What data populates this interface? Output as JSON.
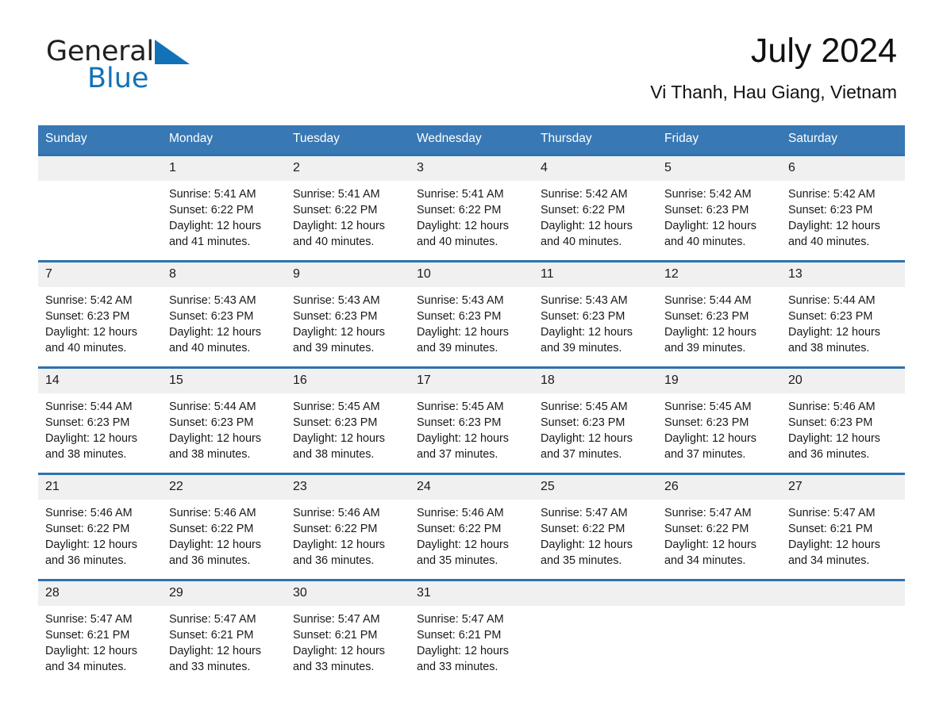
{
  "brand": {
    "name_part1": "General",
    "name_part2": "Blue",
    "triangle_color": "#1272b8"
  },
  "header": {
    "title": "July 2024",
    "subtitle": "Vi Thanh, Hau Giang, Vietnam"
  },
  "theme": {
    "header_blue": "#3878b4",
    "row_border_blue": "#2e72ae",
    "daynum_strip": "#f0f0f0",
    "text": "#1a1a1a"
  },
  "weekday_headers": [
    "Sunday",
    "Monday",
    "Tuesday",
    "Wednesday",
    "Thursday",
    "Friday",
    "Saturday"
  ],
  "weeks": [
    [
      {
        "day": "",
        "empty": true,
        "sunrise": "",
        "sunset": "",
        "daylight_line1": "",
        "daylight_line2": ""
      },
      {
        "day": "1",
        "empty": false,
        "sunrise": "Sunrise: 5:41 AM",
        "sunset": "Sunset: 6:22 PM",
        "daylight_line1": "Daylight: 12 hours",
        "daylight_line2": "and 41 minutes."
      },
      {
        "day": "2",
        "empty": false,
        "sunrise": "Sunrise: 5:41 AM",
        "sunset": "Sunset: 6:22 PM",
        "daylight_line1": "Daylight: 12 hours",
        "daylight_line2": "and 40 minutes."
      },
      {
        "day": "3",
        "empty": false,
        "sunrise": "Sunrise: 5:41 AM",
        "sunset": "Sunset: 6:22 PM",
        "daylight_line1": "Daylight: 12 hours",
        "daylight_line2": "and 40 minutes."
      },
      {
        "day": "4",
        "empty": false,
        "sunrise": "Sunrise: 5:42 AM",
        "sunset": "Sunset: 6:22 PM",
        "daylight_line1": "Daylight: 12 hours",
        "daylight_line2": "and 40 minutes."
      },
      {
        "day": "5",
        "empty": false,
        "sunrise": "Sunrise: 5:42 AM",
        "sunset": "Sunset: 6:23 PM",
        "daylight_line1": "Daylight: 12 hours",
        "daylight_line2": "and 40 minutes."
      },
      {
        "day": "6",
        "empty": false,
        "sunrise": "Sunrise: 5:42 AM",
        "sunset": "Sunset: 6:23 PM",
        "daylight_line1": "Daylight: 12 hours",
        "daylight_line2": "and 40 minutes."
      }
    ],
    [
      {
        "day": "7",
        "empty": false,
        "sunrise": "Sunrise: 5:42 AM",
        "sunset": "Sunset: 6:23 PM",
        "daylight_line1": "Daylight: 12 hours",
        "daylight_line2": "and 40 minutes."
      },
      {
        "day": "8",
        "empty": false,
        "sunrise": "Sunrise: 5:43 AM",
        "sunset": "Sunset: 6:23 PM",
        "daylight_line1": "Daylight: 12 hours",
        "daylight_line2": "and 40 minutes."
      },
      {
        "day": "9",
        "empty": false,
        "sunrise": "Sunrise: 5:43 AM",
        "sunset": "Sunset: 6:23 PM",
        "daylight_line1": "Daylight: 12 hours",
        "daylight_line2": "and 39 minutes."
      },
      {
        "day": "10",
        "empty": false,
        "sunrise": "Sunrise: 5:43 AM",
        "sunset": "Sunset: 6:23 PM",
        "daylight_line1": "Daylight: 12 hours",
        "daylight_line2": "and 39 minutes."
      },
      {
        "day": "11",
        "empty": false,
        "sunrise": "Sunrise: 5:43 AM",
        "sunset": "Sunset: 6:23 PM",
        "daylight_line1": "Daylight: 12 hours",
        "daylight_line2": "and 39 minutes."
      },
      {
        "day": "12",
        "empty": false,
        "sunrise": "Sunrise: 5:44 AM",
        "sunset": "Sunset: 6:23 PM",
        "daylight_line1": "Daylight: 12 hours",
        "daylight_line2": "and 39 minutes."
      },
      {
        "day": "13",
        "empty": false,
        "sunrise": "Sunrise: 5:44 AM",
        "sunset": "Sunset: 6:23 PM",
        "daylight_line1": "Daylight: 12 hours",
        "daylight_line2": "and 38 minutes."
      }
    ],
    [
      {
        "day": "14",
        "empty": false,
        "sunrise": "Sunrise: 5:44 AM",
        "sunset": "Sunset: 6:23 PM",
        "daylight_line1": "Daylight: 12 hours",
        "daylight_line2": "and 38 minutes."
      },
      {
        "day": "15",
        "empty": false,
        "sunrise": "Sunrise: 5:44 AM",
        "sunset": "Sunset: 6:23 PM",
        "daylight_line1": "Daylight: 12 hours",
        "daylight_line2": "and 38 minutes."
      },
      {
        "day": "16",
        "empty": false,
        "sunrise": "Sunrise: 5:45 AM",
        "sunset": "Sunset: 6:23 PM",
        "daylight_line1": "Daylight: 12 hours",
        "daylight_line2": "and 38 minutes."
      },
      {
        "day": "17",
        "empty": false,
        "sunrise": "Sunrise: 5:45 AM",
        "sunset": "Sunset: 6:23 PM",
        "daylight_line1": "Daylight: 12 hours",
        "daylight_line2": "and 37 minutes."
      },
      {
        "day": "18",
        "empty": false,
        "sunrise": "Sunrise: 5:45 AM",
        "sunset": "Sunset: 6:23 PM",
        "daylight_line1": "Daylight: 12 hours",
        "daylight_line2": "and 37 minutes."
      },
      {
        "day": "19",
        "empty": false,
        "sunrise": "Sunrise: 5:45 AM",
        "sunset": "Sunset: 6:23 PM",
        "daylight_line1": "Daylight: 12 hours",
        "daylight_line2": "and 37 minutes."
      },
      {
        "day": "20",
        "empty": false,
        "sunrise": "Sunrise: 5:46 AM",
        "sunset": "Sunset: 6:23 PM",
        "daylight_line1": "Daylight: 12 hours",
        "daylight_line2": "and 36 minutes."
      }
    ],
    [
      {
        "day": "21",
        "empty": false,
        "sunrise": "Sunrise: 5:46 AM",
        "sunset": "Sunset: 6:22 PM",
        "daylight_line1": "Daylight: 12 hours",
        "daylight_line2": "and 36 minutes."
      },
      {
        "day": "22",
        "empty": false,
        "sunrise": "Sunrise: 5:46 AM",
        "sunset": "Sunset: 6:22 PM",
        "daylight_line1": "Daylight: 12 hours",
        "daylight_line2": "and 36 minutes."
      },
      {
        "day": "23",
        "empty": false,
        "sunrise": "Sunrise: 5:46 AM",
        "sunset": "Sunset: 6:22 PM",
        "daylight_line1": "Daylight: 12 hours",
        "daylight_line2": "and 36 minutes."
      },
      {
        "day": "24",
        "empty": false,
        "sunrise": "Sunrise: 5:46 AM",
        "sunset": "Sunset: 6:22 PM",
        "daylight_line1": "Daylight: 12 hours",
        "daylight_line2": "and 35 minutes."
      },
      {
        "day": "25",
        "empty": false,
        "sunrise": "Sunrise: 5:47 AM",
        "sunset": "Sunset: 6:22 PM",
        "daylight_line1": "Daylight: 12 hours",
        "daylight_line2": "and 35 minutes."
      },
      {
        "day": "26",
        "empty": false,
        "sunrise": "Sunrise: 5:47 AM",
        "sunset": "Sunset: 6:22 PM",
        "daylight_line1": "Daylight: 12 hours",
        "daylight_line2": "and 34 minutes."
      },
      {
        "day": "27",
        "empty": false,
        "sunrise": "Sunrise: 5:47 AM",
        "sunset": "Sunset: 6:21 PM",
        "daylight_line1": "Daylight: 12 hours",
        "daylight_line2": "and 34 minutes."
      }
    ],
    [
      {
        "day": "28",
        "empty": false,
        "sunrise": "Sunrise: 5:47 AM",
        "sunset": "Sunset: 6:21 PM",
        "daylight_line1": "Daylight: 12 hours",
        "daylight_line2": "and 34 minutes."
      },
      {
        "day": "29",
        "empty": false,
        "sunrise": "Sunrise: 5:47 AM",
        "sunset": "Sunset: 6:21 PM",
        "daylight_line1": "Daylight: 12 hours",
        "daylight_line2": "and 33 minutes."
      },
      {
        "day": "30",
        "empty": false,
        "sunrise": "Sunrise: 5:47 AM",
        "sunset": "Sunset: 6:21 PM",
        "daylight_line1": "Daylight: 12 hours",
        "daylight_line2": "and 33 minutes."
      },
      {
        "day": "31",
        "empty": false,
        "sunrise": "Sunrise: 5:47 AM",
        "sunset": "Sunset: 6:21 PM",
        "daylight_line1": "Daylight: 12 hours",
        "daylight_line2": "and 33 minutes."
      },
      {
        "day": "",
        "empty": true,
        "sunrise": "",
        "sunset": "",
        "daylight_line1": "",
        "daylight_line2": ""
      },
      {
        "day": "",
        "empty": true,
        "sunrise": "",
        "sunset": "",
        "daylight_line1": "",
        "daylight_line2": ""
      },
      {
        "day": "",
        "empty": true,
        "sunrise": "",
        "sunset": "",
        "daylight_line1": "",
        "daylight_line2": ""
      }
    ]
  ]
}
